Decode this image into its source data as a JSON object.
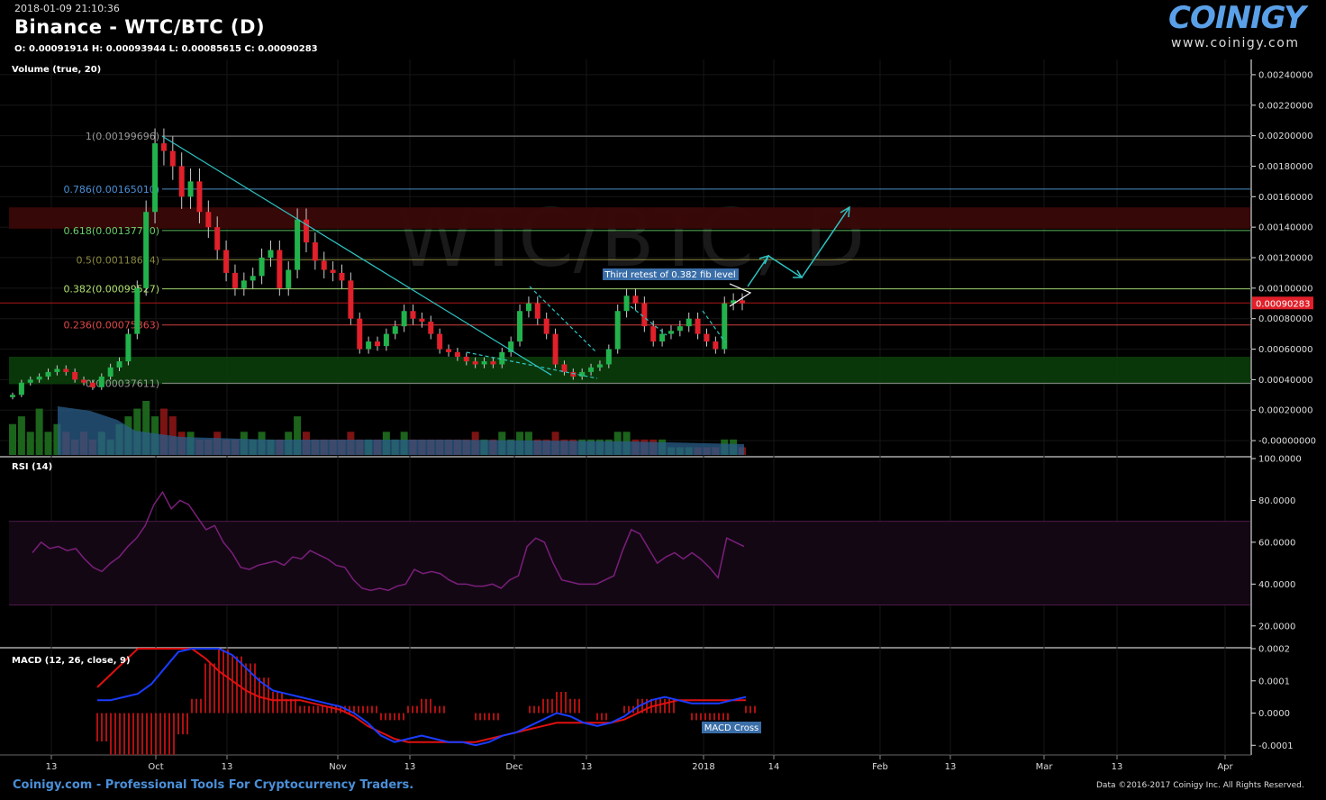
{
  "header": {
    "timestamp": "2018-01-09 21:10:36",
    "title": "Binance - WTC/BTC (D)",
    "ohlc": "O: 0.00091914 H: 0.00093944 L: 0.00085615 C: 0.00090283"
  },
  "brand": {
    "name": "COINIGY",
    "url": "www.coinigy.com"
  },
  "footer": {
    "left": "Coinigy.com - Professional Tools For Cryptocurrency Traders.",
    "right": "Data ©2016-2017 Coinigy Inc. All Rights Reserved."
  },
  "panels": {
    "price_label": "Volume (true, 20)",
    "rsi_label": "RSI (14)",
    "macd_label": "MACD (12, 26, close, 9)"
  },
  "colors": {
    "up": "#22b24c",
    "down": "#e0202a",
    "trendline": "#2ec4c4",
    "rsi": "#7a1f7a",
    "macd": "#1a3cff",
    "signal": "#e01010",
    "hist": "#b01010",
    "green_zone": "#0b3a0b",
    "red_zone": "#3a0808",
    "last_price_bg": "#e0202a"
  },
  "chart_data": [
    {
      "type": "candlestick",
      "title": "Binance - WTC/BTC (D)",
      "ylim": [
        -0.0001,
        0.0025
      ],
      "y_ticks": [
        "0.00240000",
        "0.00220000",
        "0.00200000",
        "0.00180000",
        "0.00160000",
        "0.00140000",
        "0.00120000",
        "0.00100000",
        "0.00080000",
        "0.00060000",
        "0.00040000",
        "0.00020000",
        "-0.00000000"
      ],
      "x_ticks": [
        "13",
        "Oct",
        "13",
        "Nov",
        "13",
        "Dec",
        "13",
        "2018",
        "14",
        "Feb",
        "13",
        "Mar",
        "13",
        "Apr"
      ],
      "last_price": "0.00090283",
      "fib_levels": [
        {
          "label": "1(0.00199696)",
          "ratio": 1,
          "value": 0.00199696
        },
        {
          "label": "0.786(0.00165010)",
          "ratio": 0.786,
          "value": 0.0016501
        },
        {
          "label": "0.618(0.00137780)",
          "ratio": 0.618,
          "value": 0.0013778
        },
        {
          "label": "0.5(0.00118654)",
          "ratio": 0.5,
          "value": 0.00118654
        },
        {
          "label": "0.382(0.00099527)",
          "ratio": 0.382,
          "value": 0.00099527
        },
        {
          "label": "0.236(0.00075863)",
          "ratio": 0.236,
          "value": 0.00075863
        },
        {
          "label": "0(0.00037611)",
          "ratio": 0,
          "value": 0.00037611
        }
      ],
      "zones": [
        {
          "kind": "resistance",
          "from": 0.00139,
          "to": 0.00153
        },
        {
          "kind": "support",
          "from": 0.00037,
          "to": 0.00055
        }
      ],
      "annotation": "Third retest of 0.382 fib level",
      "close_path": [
        0.0003,
        0.00038,
        0.0004,
        0.00042,
        0.00045,
        0.00047,
        0.00045,
        0.0004,
        0.00038,
        0.00035,
        0.00042,
        0.00048,
        0.00052,
        0.0007,
        0.001,
        0.0015,
        0.00195,
        0.0019,
        0.0018,
        0.0016,
        0.0017,
        0.0015,
        0.0014,
        0.00125,
        0.0011,
        0.001,
        0.00105,
        0.00108,
        0.0012,
        0.00125,
        0.001,
        0.00112,
        0.00145,
        0.0013,
        0.00118,
        0.00112,
        0.0011,
        0.00105,
        0.0008,
        0.0006,
        0.00065,
        0.00062,
        0.0007,
        0.00075,
        0.00085,
        0.0008,
        0.00078,
        0.0007,
        0.0006,
        0.00058,
        0.00055,
        0.00052,
        0.0005,
        0.00052,
        0.0005,
        0.00058,
        0.00065,
        0.00085,
        0.0009,
        0.0008,
        0.0007,
        0.0005,
        0.00045,
        0.00042,
        0.00045,
        0.00048,
        0.0005,
        0.0006,
        0.00085,
        0.00095,
        0.0009,
        0.00075,
        0.00065,
        0.0007,
        0.00072,
        0.00075,
        0.0008,
        0.0007,
        0.00065,
        0.0006,
        0.0009,
        0.00092,
        0.0009
      ]
    },
    {
      "type": "bar",
      "title": "Volume (true, 20)",
      "values": [
        0.4,
        0.5,
        0.3,
        0.6,
        0.3,
        0.4,
        0.3,
        0.2,
        0.3,
        0.2,
        0.3,
        0.2,
        0.4,
        0.5,
        0.6,
        0.7,
        0.5,
        0.6,
        0.5,
        0.3,
        0.3,
        0.2,
        0.2,
        0.3,
        0.2,
        0.2,
        0.3,
        0.2,
        0.3,
        0.2,
        0.2,
        0.3,
        0.5,
        0.3,
        0.2,
        0.2,
        0.2,
        0.2,
        0.3,
        0.2,
        0.2,
        0.2,
        0.3,
        0.2,
        0.3,
        0.2,
        0.2,
        0.2,
        0.2,
        0.2,
        0.2,
        0.2,
        0.3,
        0.2,
        0.2,
        0.3,
        0.2,
        0.3,
        0.3,
        0.2,
        0.2,
        0.3,
        0.2,
        0.2,
        0.2,
        0.2,
        0.2,
        0.2,
        0.3,
        0.3,
        0.2,
        0.2,
        0.2,
        0.2,
        0.1,
        0.1,
        0.1,
        0.1,
        0.1,
        0.1,
        0.2,
        0.2,
        0.1
      ]
    },
    {
      "type": "line",
      "title": "RSI (14)",
      "ylim": [
        10,
        100
      ],
      "y_ticks": [
        "100.0000",
        "80.0000",
        "60.0000",
        "40.0000",
        "20.0000"
      ],
      "band": [
        30,
        70
      ],
      "series": [
        {
          "name": "RSI",
          "values": [
            55,
            60,
            57,
            58,
            56,
            57,
            52,
            48,
            46,
            50,
            53,
            58,
            62,
            68,
            78,
            84,
            76,
            80,
            78,
            72,
            66,
            68,
            60,
            55,
            48,
            47,
            49,
            50,
            51,
            49,
            53,
            52,
            56,
            54,
            52,
            49,
            48,
            42,
            38,
            37,
            38,
            37,
            39,
            40,
            47,
            45,
            46,
            45,
            42,
            40,
            40,
            39,
            39,
            40,
            38,
            42,
            44,
            58,
            62,
            60,
            50,
            42,
            41,
            40,
            40,
            40,
            42,
            44,
            56,
            66,
            64,
            57,
            50,
            53,
            55,
            52,
            55,
            52,
            48,
            43,
            62,
            60,
            58
          ]
        }
      ]
    },
    {
      "type": "line",
      "title": "MACD (12, 26, close, 9)",
      "ylim": [
        -0.00013,
        0.0002
      ],
      "y_ticks": [
        "0.0002",
        "0.0001",
        "0.0000",
        "-0.0001"
      ],
      "series": [
        {
          "name": "MACD",
          "values": [
            4e-05,
            4e-05,
            5e-05,
            6e-05,
            9e-05,
            0.00014,
            0.00019,
            0.00022,
            0.00024,
            0.00022,
            0.00018,
            0.00014,
            0.0001,
            7e-05,
            6e-05,
            5e-05,
            4e-05,
            3e-05,
            2e-05,
            0.0,
            -3e-05,
            -7e-05,
            -9e-05,
            -8e-05,
            -7e-05,
            -8e-05,
            -9e-05,
            -9e-05,
            -0.0001,
            -9e-05,
            -7e-05,
            -6e-05,
            -4e-05,
            -2e-05,
            0.0,
            -1e-05,
            -3e-05,
            -4e-05,
            -3e-05,
            -1e-05,
            2e-05,
            4e-05,
            5e-05,
            4e-05,
            3e-05,
            3e-05,
            3e-05,
            4e-05,
            5e-05
          ]
        },
        {
          "name": "Signal",
          "values": [
            8e-05,
            0.00012,
            0.00016,
            0.0002,
            0.00022,
            0.00023,
            0.00022,
            0.0002,
            0.00017,
            0.00013,
            0.0001,
            7e-05,
            5e-05,
            4e-05,
            4e-05,
            4e-05,
            3e-05,
            2e-05,
            1e-05,
            -1e-05,
            -4e-05,
            -6e-05,
            -8e-05,
            -9e-05,
            -9e-05,
            -9e-05,
            -9e-05,
            -9e-05,
            -9e-05,
            -8e-05,
            -7e-05,
            -6e-05,
            -5e-05,
            -4e-05,
            -3e-05,
            -3e-05,
            -3e-05,
            -3e-05,
            -3e-05,
            -2e-05,
            0.0,
            2e-05,
            3e-05,
            4e-05,
            4e-05,
            4e-05,
            4e-05,
            4e-05,
            4e-05
          ]
        }
      ],
      "annotation": "MACD Cross"
    }
  ]
}
